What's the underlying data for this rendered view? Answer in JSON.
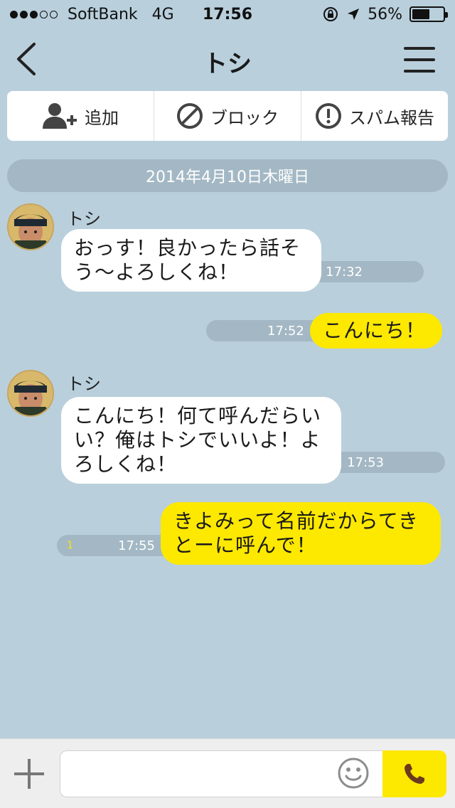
{
  "status_bar": {
    "carrier": "SoftBank",
    "network": "4G",
    "time": "17:56",
    "battery": "56%",
    "battery_level": 0.56,
    "signal_bars": 3,
    "signal_max": 5
  },
  "nav": {
    "title": "トシ"
  },
  "actions": {
    "add_label": "追加",
    "block_label": "ブロック",
    "spam_label": "スパム報告"
  },
  "date_divider": "2014年4月10日木曜日",
  "messages": [
    {
      "direction": "in",
      "sender": "トシ",
      "lines": [
        "おっす！良かったら話そ",
        "う〜よろしくね！"
      ],
      "time": "17:32"
    },
    {
      "direction": "out",
      "lines": [
        "こんにち！"
      ],
      "time": "17:52"
    },
    {
      "direction": "in",
      "sender": "トシ",
      "lines": [
        "こんにち！何て呼んだらい",
        "い？俺はトシでいいよ！よ",
        "ろしくね！"
      ],
      "time": "17:53"
    },
    {
      "direction": "out",
      "lines": [
        "きよみって名前だからてき",
        "とーに呼んで！"
      ],
      "time": "17:55",
      "read_count": "1"
    }
  ],
  "input": {
    "placeholder": ""
  },
  "colors": {
    "background": "#b9cfdc",
    "outgoing_bubble": "#fde800",
    "incoming_bubble": "#ffffff",
    "time_pill": "#a3b8c4"
  },
  "icons": {
    "back": "chevron-left-icon",
    "menu": "hamburger-icon",
    "add_friend": "add-person-icon",
    "block": "block-icon",
    "spam": "exclamation-circle-icon",
    "attach": "plus-icon",
    "emoji": "smiley-icon",
    "call": "phone-icon"
  }
}
